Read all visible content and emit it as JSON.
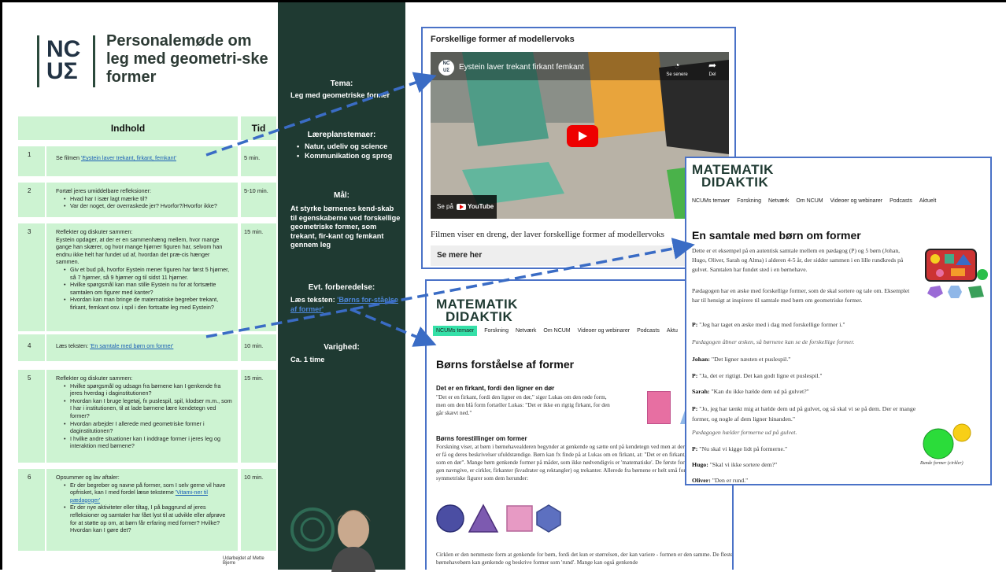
{
  "doc": {
    "logo_line1": "NC",
    "logo_line2": "UΣ",
    "title": "Personalemøde om leg med geometri-ske former",
    "col_indhold": "Indhold",
    "col_tid": "Tid",
    "rows": [
      {
        "num": "1",
        "intro": "Se filmen ",
        "link": "'Eystein laver trekant, firkant, femkant'",
        "tid": "5 min."
      },
      {
        "num": "2",
        "intro": "Fortæl jeres umiddelbare refleksioner:",
        "bullets": [
          "Hvad har I især lagt mærke til?",
          "Var der noget, der overraskede jer? Hvorfor?/Hvorfor ikke?"
        ],
        "tid": "5-10 min."
      },
      {
        "num": "3",
        "intro": "Reflekter og diskuter sammen:",
        "para": "Eystein opdager, at der er en sammenhæng mellem, hvor mange gange han skærer, og hvor mange hjørner figuren har, selvom han endnu ikke helt har fundet ud af, hvordan det præ-cis hænger sammen.",
        "bullets": [
          "Giv et bud på, hvorfor Eystein mener figuren har først 5 hjørner, så 7 hjørner, så 9 hjørner og til sidst 11 hjørner.",
          "Hvilke spørgsmål kan man stille Eystein nu for at fortsætte samtalen om figurer med kanter?",
          "Hvordan kan man bringe de matematiske begreber trekant, firkant, femkant osv. i spil i den fortsatte leg med Eystein?"
        ],
        "tid": "15 min."
      },
      {
        "num": "4",
        "intro": "Læs teksten: ",
        "link": "'En samtale med børn om former'",
        "tid": "10 min."
      },
      {
        "num": "5",
        "intro": "Reflekter og diskuter sammen:",
        "bullets": [
          "Hvilke spørgsmål og udsagn fra børnene kan I genkende fra jeres hverdag i daginstitutionen?",
          "Hvordan kan I bruge legetøj, fx puslespil, spil, klodser m.m., som I har i institutionen, til at lade børnene lære kendetegn ved former?",
          "Hvordan arbejder I allerede med geometriske former i daginstitutionen?",
          "I hvilke andre situationer kan I inddrage former i jeres leg og interaktion med børnene?"
        ],
        "tid": "15 min."
      },
      {
        "num": "6",
        "intro": "Opsummer og lav aftaler:",
        "bullets_html": true,
        "b1_pre": "Er der begreber og navne på former, som I selv gerne vil have opfrisket, kan I med fordel læse teksterne ",
        "b1_link": "'Vitami-ner til pædagoger'",
        "b2": "Er der nye aktiviteter eller tiltag, I på baggrund af jeres refleksioner og samtaler har fået lyst til at udvikle eller afprøve for at støtte op om, at børn får erfaring med former? Hvilke? Hvordan kan I gøre det?",
        "tid": "10 min."
      }
    ],
    "credit": "Udarbejdet af Mette Bjerre"
  },
  "band": {
    "tema_h": "Tema:",
    "tema_t": "Leg med geometriske former",
    "laere_h": "Læreplanstemaer:",
    "laere_items": [
      "Natur, udeliv og science",
      "Kommunikation og sprog"
    ],
    "maal_h": "Mål:",
    "maal_t": "At styrke børnenes kend-skab til egenskaberne ved forskellige geometriske former, som trekant, fir-kant og femkant gennem leg",
    "forb_h": "Evt. forberedelse:",
    "forb_pre": "Læs teksten: ",
    "forb_link": "'Børns for-ståelse af former'",
    "var_h": "Varighed:",
    "var_t": "Ca. 1 time"
  },
  "video": {
    "panel_title": "Forskellige former af modellervoks",
    "yt_title": "Eystein laver trekant firkant femkant",
    "watch_later": "Se senere",
    "share": "Del",
    "watch_on": "Se på",
    "yt_brand": "YouTube",
    "caption": "Filmen viser en dreng, der laver forskellige former af modellervoks",
    "more": "Se mere her"
  },
  "article1": {
    "logo1": "MATEMATIK",
    "logo2": "DIDAKTIK",
    "nav": [
      "NCUMs temaer",
      "Forskning",
      "Netværk",
      "Om NCUM",
      "Videoer og webinarer",
      "Podcasts",
      "Aktu"
    ],
    "heading": "Børns forståelse af former",
    "sub1": "Det er en firkant, fordi den ligner en dør",
    "p1": "\"Det er en firkant, fordi den ligner en dør,\" siger Lukas om den røde form, men om den blå form fortæller Lukas: \"Det er ikke en rigtig firkant, for den går skævt ned.\"",
    "sub2": "Børns forestillinger om former",
    "p2": "Forskning viser, at børn i børnehavealderen begynder at genkende og sætte ord på kendetegn ved men at deres forestillinger ofte er få og deres beskrivelser ufuldstændige. Børn kan fx finde på at Lukas om en firkant, at: \"Det er en firkant, fordi den ser ud som en dør\". Mange børn genkende former på måder, som ikke nødvendigvis er 'matematiske'. De første former, børn lærer at gen navngive, er cirkler, firkanter (kvadrater og rektangler) og trekanter. Allerede fra børnene er helt små foretrækker de ofte symmetriske figurer som dem herunder:",
    "p3": "Cirklen er den nemmeste form at genkende for børn, fordi det kun er størrelsen, der kan variere - formen er den samme. De fleste børnehavebørn kan genkende og beskrive former som 'rund'. Mange kan også genkende"
  },
  "article2": {
    "logo1": "MATEMATIK",
    "logo2": "DIDAKTIK",
    "nav": [
      "NCUMs temaer",
      "Forskning",
      "Netværk",
      "Om NCUM",
      "Videoer og webinarer",
      "Podcasts",
      "Aktuelt"
    ],
    "heading": "En samtale med børn om former",
    "p1": "Dette er et eksempel på en autentisk samtale mellem en pædagog (P) og 5 børn (Johan, Hugo, Oliver, Sarah og Alma) i alderen 4-5 år, der sidder sammen i en lille rundkreds på gulvet. Samtalen har fundet sted i en børnehave.",
    "p2": "Pædagogen har en æske med forskellige former, som de skal sortere og tale om. Eksemplet har til hensigt at inspirere til samtale med børn om geometriske former.",
    "lines": [
      {
        "who": "P:",
        "text": " \"Jeg har taget en æske med i dag med forskellige former i.\""
      },
      {
        "italic": "Pædagogen åbner æsken, så børnene kan se de forskellige former."
      },
      {
        "who": "Johan:",
        "text": " \"Det ligner næsten et puslespil.\""
      },
      {
        "who": "P:",
        "text": " \"Ja, det er rigtigt. Det kan godt ligne et puslespil.\""
      },
      {
        "who": "Sarah:",
        "text": " \"Kan du ikke hælde dem ud på gulvet?\""
      },
      {
        "who": "P:",
        "text": " \"Jo, jeg har tænkt mig at hælde dem ud på gulvet, og så skal vi se på dem. Der er mange former, og nogle af dem ligner hinanden.\""
      },
      {
        "italic": "Pædagogen hælder formerne ud på gulvet."
      },
      {
        "who": "P:",
        "text": " \"Nu skal vi kigge lidt på formerne.\""
      },
      {
        "who": "Hugo:",
        "text": " \"Skal vi ikke sortere dem?\""
      },
      {
        "who": "Oliver:",
        "text": " \"Den er rund.\""
      }
    ],
    "circles_caption": "Runde former (cirkler)"
  },
  "colors": {
    "mint": "#cdf3d2",
    "dark_green": "#1f3a32",
    "arrow_blue": "#3a6cc5",
    "panel_border": "#4a72c7",
    "nav_active": "#35e0a8"
  }
}
